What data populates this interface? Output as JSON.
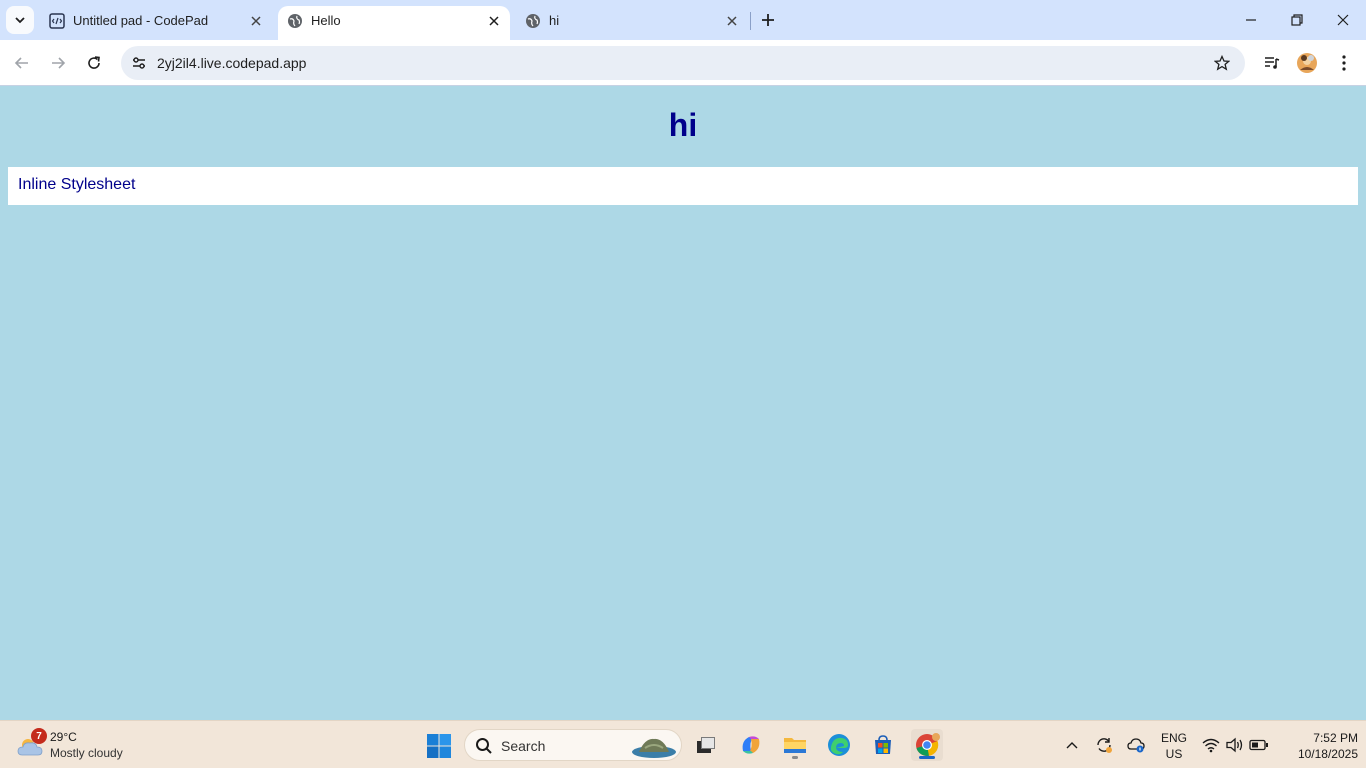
{
  "browser": {
    "tabs": [
      {
        "title": "Untitled pad - CodePad",
        "active": false
      },
      {
        "title": "Hello",
        "active": true
      },
      {
        "title": "hi",
        "active": false
      }
    ],
    "url": "2yj2il4.live.codepad.app"
  },
  "page": {
    "heading": "hi",
    "box_text": "Inline Stylesheet",
    "colors": {
      "background": "#add8e6",
      "text": "#00008b",
      "box": "#ffffff"
    }
  },
  "taskbar": {
    "weather": {
      "badge": "7",
      "temperature": "29°C",
      "condition": "Mostly cloudy"
    },
    "search_placeholder": "Search",
    "language": {
      "line1": "ENG",
      "line2": "US"
    },
    "clock": {
      "time": "7:52 PM",
      "date": "10/18/2025"
    }
  }
}
